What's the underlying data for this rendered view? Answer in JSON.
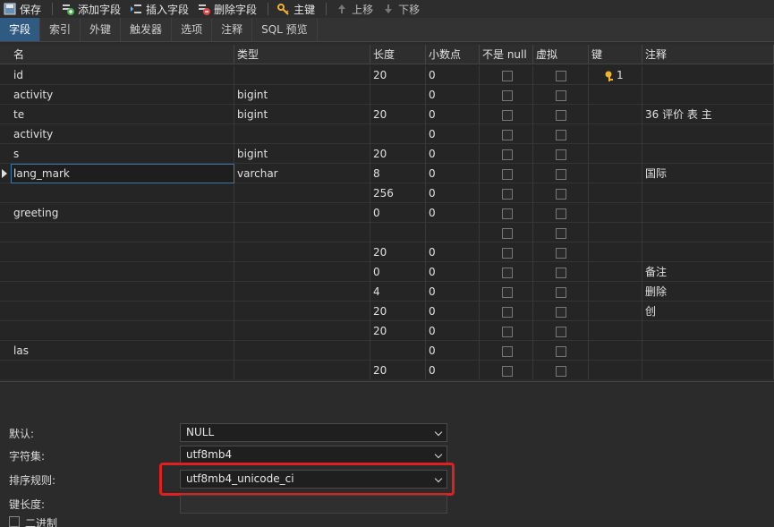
{
  "toolbar": {
    "save": "保存",
    "add_field": "添加字段",
    "insert_field": "插入字段",
    "delete_field": "删除字段",
    "primary_key": "主键",
    "move_up": "上移",
    "move_down": "下移"
  },
  "tabs": [
    "字段",
    "索引",
    "外键",
    "触发器",
    "选项",
    "注释",
    "SQL 预览"
  ],
  "columns": [
    "名",
    "类型",
    "长度",
    "小数点",
    "不是 null",
    "虚拟",
    "键",
    "注释"
  ],
  "rows": [
    {
      "name": "id",
      "type": "",
      "length": "20",
      "decimals": "0",
      "not_null": true,
      "virtual": false,
      "key": "1",
      "comment": ""
    },
    {
      "name": "activity",
      "type": "bigint",
      "length": "",
      "decimals": "0",
      "not_null": false,
      "virtual": false,
      "key": "",
      "comment": ""
    },
    {
      "name": "te",
      "type": "bigint",
      "length": "20",
      "decimals": "0",
      "not_null": false,
      "virtual": false,
      "key": "",
      "comment": "36 评价 表 主"
    },
    {
      "name": "activity",
      "type": "",
      "length": "",
      "decimals": "0",
      "not_null": false,
      "virtual": false,
      "key": "",
      "comment": ""
    },
    {
      "name": "s",
      "type": "bigint",
      "length": "20",
      "decimals": "0",
      "not_null": false,
      "virtual": false,
      "key": "",
      "comment": ""
    },
    {
      "name": "lang_mark",
      "type": "varchar",
      "length": "8",
      "decimals": "0",
      "not_null": false,
      "virtual": false,
      "key": "",
      "comment": "国际"
    },
    {
      "name": "",
      "type": "",
      "length": "256",
      "decimals": "0",
      "not_null": false,
      "virtual": false,
      "key": "",
      "comment": ""
    },
    {
      "name": "greeting",
      "type": "",
      "length": "0",
      "decimals": "0",
      "not_null": false,
      "virtual": false,
      "key": "",
      "comment": ""
    },
    {
      "name": "",
      "type": "",
      "length": "",
      "decimals": "",
      "not_null": false,
      "virtual": false,
      "key": "",
      "comment": ""
    },
    {
      "name": "",
      "type": "",
      "length": "20",
      "decimals": "0",
      "not_null": false,
      "virtual": false,
      "key": "",
      "comment": ""
    },
    {
      "name": "",
      "type": "",
      "length": "0",
      "decimals": "0",
      "not_null": false,
      "virtual": false,
      "key": "",
      "comment": "备注"
    },
    {
      "name": "",
      "type": "",
      "length": "4",
      "decimals": "0",
      "not_null": false,
      "virtual": false,
      "key": "",
      "comment": "删除"
    },
    {
      "name": "",
      "type": "",
      "length": "20",
      "decimals": "0",
      "not_null": false,
      "virtual": false,
      "key": "",
      "comment": "创"
    },
    {
      "name": "",
      "type": "",
      "length": "20",
      "decimals": "0",
      "not_null": false,
      "virtual": false,
      "key": "",
      "comment": ""
    },
    {
      "name": "las",
      "type": "",
      "length": "",
      "decimals": "0",
      "not_null": false,
      "virtual": false,
      "key": "",
      "comment": ""
    },
    {
      "name": "",
      "type": "",
      "length": "20",
      "decimals": "0",
      "not_null": false,
      "virtual": false,
      "key": "",
      "comment": ""
    }
  ],
  "bottom": {
    "default_label": "默认:",
    "default_value": "NULL",
    "charset_label": "字符集:",
    "charset_value": "utf8mb4",
    "collation_label": "排序规则:",
    "collation_value": "utf8mb4_unicode_ci",
    "keylen_label": "键长度:",
    "binary_label": "二进制"
  },
  "colors": {
    "accent": "#2f5b82",
    "highlight": "#e02020"
  }
}
